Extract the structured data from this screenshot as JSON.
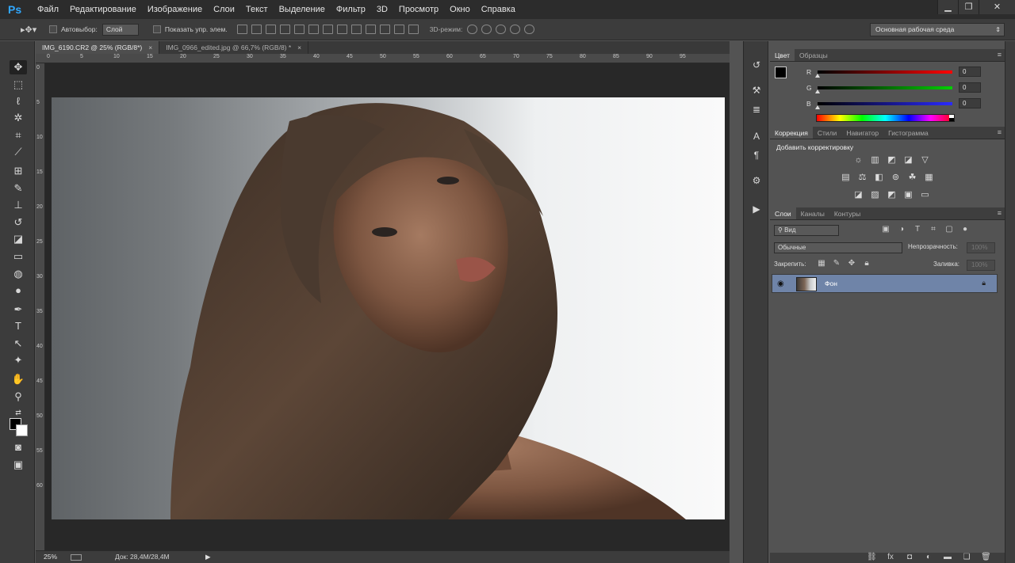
{
  "app": {
    "logo": "Ps"
  },
  "menu": [
    "Файл",
    "Редактирование",
    "Изображение",
    "Слои",
    "Текст",
    "Выделение",
    "Фильтр",
    "3D",
    "Просмотр",
    "Окно",
    "Справка"
  ],
  "window_controls": {
    "minimize": "▁",
    "restore": "❐",
    "close": "✕"
  },
  "options": {
    "tool_icon": "move-tool-icon",
    "autoselect_label": "Автовыбор:",
    "autoselect_value": "Слой",
    "show_transform_label": "Показать упр. элем.",
    "mode_3d_label": "3D-режим:",
    "workspace": "Основная рабочая среда"
  },
  "tabs": [
    {
      "label": "IMG_6190.CR2 @ 25% (RGB/8*)",
      "close": "×"
    },
    {
      "label": "IMG_0966_edited.jpg @ 66,7% (RGB/8) *",
      "close": "×"
    }
  ],
  "ruler": {
    "top": [
      "0",
      "5",
      "10",
      "15",
      "20",
      "25",
      "30",
      "35",
      "40",
      "45",
      "50",
      "55",
      "60",
      "65",
      "70",
      "75",
      "80",
      "85",
      "90",
      "95"
    ],
    "left": [
      "0",
      "5",
      "10",
      "15",
      "20",
      "25",
      "30",
      "35",
      "40",
      "45",
      "50",
      "55",
      "60"
    ]
  },
  "status": {
    "zoom": "25%",
    "doc": "Док: 28,4M/28,4M",
    "arrow": "▶"
  },
  "tools": [
    "move-tool-icon",
    "marquee-icon",
    "lasso-icon",
    "magic-wand-icon",
    "crop-icon",
    "eyedropper-icon",
    "healing-icon",
    "brush-icon",
    "stamp-icon",
    "history-brush-icon",
    "eraser-icon",
    "gradient-icon",
    "blur-icon",
    "dodge-icon",
    "pen-icon",
    "type-icon",
    "path-select-icon",
    "shape-icon",
    "hand-icon",
    "zoom-icon"
  ],
  "color_panel": {
    "tabs": [
      "Цвет",
      "Образцы"
    ],
    "sliders": [
      {
        "label": "R",
        "value": "0",
        "color": "#ff0000"
      },
      {
        "label": "G",
        "value": "0",
        "color": "#00d000"
      },
      {
        "label": "B",
        "value": "0",
        "color": "#2a2aff"
      }
    ]
  },
  "adjustments_panel": {
    "tabs": [
      "Коррекция",
      "Стили",
      "Навигатор",
      "Гистограмма"
    ],
    "title": "Добавить корректировку"
  },
  "layers_panel": {
    "tabs": [
      "Слои",
      "Каналы",
      "Контуры"
    ],
    "search": "Вид",
    "blend_mode": "Обычные",
    "opacity_label": "Непрозрачность:",
    "opacity_value": "100%",
    "lock_label": "Закрепить:",
    "fill_label": "Заливка:",
    "fill_value": "100%",
    "layer_name": "Фон"
  }
}
